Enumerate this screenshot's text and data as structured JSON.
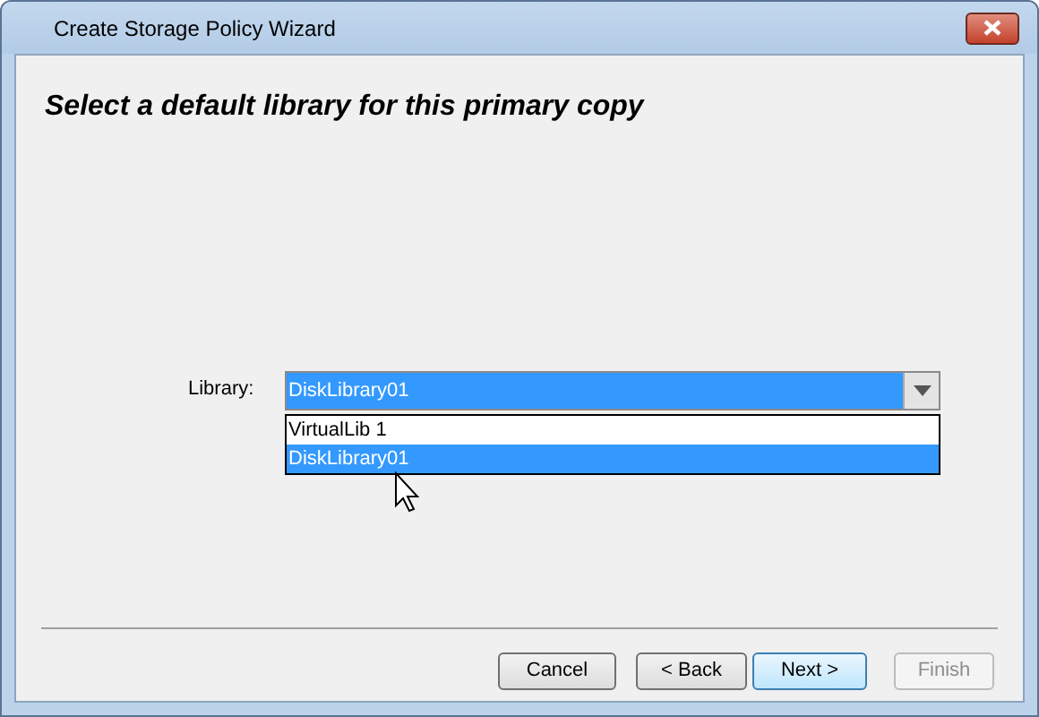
{
  "window": {
    "title": "Create Storage Policy Wizard"
  },
  "heading": "Select a default library for this primary copy",
  "library": {
    "label": "Library:",
    "value": "DiskLibrary01",
    "expanded": true,
    "options": [
      {
        "label": "VirtualLib 1",
        "selected": false
      },
      {
        "label": "DiskLibrary01",
        "selected": true
      }
    ]
  },
  "buttons": [
    {
      "label": "Cancel",
      "disabled": false,
      "default": false
    },
    {
      "label": "< Back",
      "disabled": false,
      "default": false
    },
    {
      "label": "Next >",
      "disabled": false,
      "default": true
    },
    {
      "label": "Finish",
      "disabled": true,
      "default": false
    }
  ]
}
